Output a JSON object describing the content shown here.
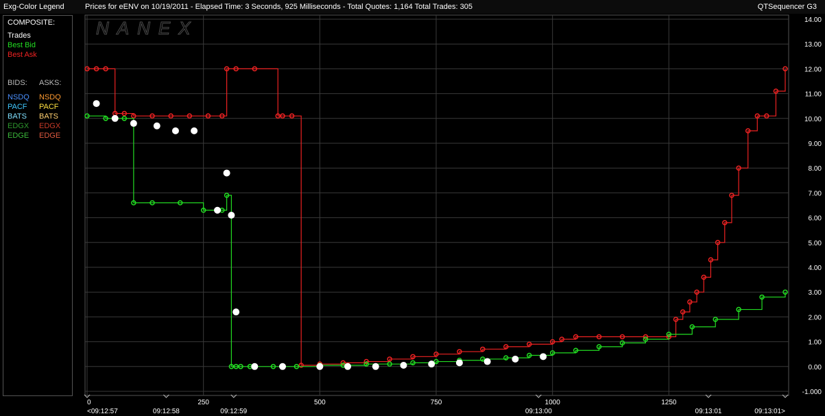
{
  "header": {
    "legend_title": "Exg-Color Legend",
    "chart_title": "Prices for  eENV  on  10/19/2011  -  Elapsed Time: 3 Seconds, 925 Milliseconds  -  Total Quotes: 1,164  Total Trades: 305",
    "app_name": "QTSequencer G3"
  },
  "watermark": "NANEX",
  "legend": {
    "composite_label": "COMPOSITE:",
    "composite": [
      {
        "label": "Trades",
        "color": "#ffffff"
      },
      {
        "label": "Best Bid",
        "color": "#22dd22"
      },
      {
        "label": "Best Ask",
        "color": "#ee2222"
      }
    ],
    "bids_label": "BIDS:",
    "asks_label": "ASKS:",
    "exchanges": [
      {
        "bid": "NSDQ",
        "bid_color": "#4a90ff",
        "ask": "NSDQ",
        "ask_color": "#ff9a30"
      },
      {
        "bid": "PACF",
        "bid_color": "#40c8ff",
        "ask": "PACF",
        "ask_color": "#ffe040"
      },
      {
        "bid": "BATS",
        "bid_color": "#80e0ff",
        "ask": "BATS",
        "ask_color": "#ffd070"
      },
      {
        "bid": "EDGX",
        "bid_color": "#2e9a2e",
        "ask": "EDGX",
        "ask_color": "#c83a28"
      },
      {
        "bid": "EDGE",
        "bid_color": "#3cbc3c",
        "ask": "EDGE",
        "ask_color": "#e05a40"
      }
    ]
  },
  "chart_data": {
    "type": "line",
    "title": "Prices for  eENV  on  10/19/2011  -  Elapsed Time: 3 Seconds, 925 Milliseconds  -  Total Quotes: 1,164  Total Trades: 305",
    "xlim": [
      0,
      1500
    ],
    "ylim": [
      -1.0,
      14.0
    ],
    "x_ticks": [
      0,
      250,
      500,
      750,
      1000,
      1250
    ],
    "x_tick_labels": [
      "0",
      "250",
      "500",
      "750",
      "1000",
      "1250"
    ],
    "y_ticks": [
      -1,
      0,
      1,
      2,
      3,
      4,
      5,
      6,
      7,
      8,
      9,
      10,
      11,
      12,
      13,
      14
    ],
    "y_tick_labels": [
      "-1.000",
      "0.00",
      "1.00",
      "2.00",
      "3.00",
      "4.00",
      "5.00",
      "6.00",
      "7.00",
      "8.00",
      "9.00",
      "10.00",
      "11.00",
      "12.00",
      "13.00",
      "14.00"
    ],
    "time_labels": [
      {
        "x": 0,
        "label": "<09:12:57"
      },
      {
        "x": 170,
        "label": "09:12:58"
      },
      {
        "x": 315,
        "label": "09:12:59"
      },
      {
        "x": 970,
        "label": "09:13:00"
      },
      {
        "x": 1335,
        "label": "09:13:01"
      },
      {
        "x": 1500,
        "label": "09:13:01>"
      }
    ],
    "grid": true,
    "series": [
      {
        "name": "Best Ask",
        "color": "#ee2222",
        "x": [
          0,
          20,
          40,
          60,
          80,
          100,
          140,
          180,
          220,
          260,
          290,
          300,
          320,
          360,
          410,
          420,
          440,
          460,
          500,
          550,
          600,
          650,
          700,
          750,
          800,
          850,
          900,
          950,
          1000,
          1020,
          1050,
          1100,
          1150,
          1200,
          1250,
          1265,
          1280,
          1295,
          1310,
          1325,
          1340,
          1355,
          1370,
          1385,
          1400,
          1420,
          1440,
          1460,
          1480,
          1500
        ],
        "y": [
          12.0,
          12.0,
          12.0,
          10.2,
          10.2,
          10.1,
          10.1,
          10.1,
          10.1,
          10.1,
          10.1,
          12.0,
          12.0,
          12.0,
          10.1,
          10.1,
          10.1,
          0.05,
          0.1,
          0.15,
          0.2,
          0.3,
          0.4,
          0.5,
          0.6,
          0.7,
          0.8,
          0.9,
          1.0,
          1.1,
          1.2,
          1.2,
          1.2,
          1.2,
          1.2,
          1.9,
          2.2,
          2.6,
          3.0,
          3.6,
          4.3,
          5.0,
          5.8,
          6.9,
          8.0,
          9.5,
          10.1,
          10.1,
          11.1,
          12.0
        ]
      },
      {
        "name": "Best Bid",
        "color": "#22dd22",
        "x": [
          0,
          40,
          80,
          100,
          140,
          200,
          250,
          290,
          300,
          310,
          320,
          330,
          350,
          400,
          450,
          500,
          550,
          600,
          650,
          700,
          750,
          800,
          850,
          900,
          950,
          1000,
          1050,
          1100,
          1150,
          1200,
          1250,
          1300,
          1350,
          1400,
          1450,
          1500
        ],
        "y": [
          10.1,
          10.0,
          10.0,
          6.6,
          6.6,
          6.6,
          6.3,
          6.3,
          6.9,
          0.0,
          0.0,
          0.0,
          0.0,
          0.0,
          0.0,
          0.05,
          0.05,
          0.1,
          0.1,
          0.15,
          0.2,
          0.25,
          0.3,
          0.35,
          0.45,
          0.55,
          0.65,
          0.8,
          0.95,
          1.1,
          1.3,
          1.6,
          1.9,
          2.3,
          2.8,
          3.0
        ]
      },
      {
        "name": "Trades",
        "color": "#ffffff",
        "x": [
          20,
          60,
          100,
          150,
          190,
          230,
          280,
          300,
          310,
          320,
          360,
          420,
          500,
          560,
          620,
          680,
          740,
          800,
          860,
          920,
          980
        ],
        "y": [
          10.6,
          10.0,
          9.8,
          9.7,
          9.5,
          9.5,
          6.3,
          7.8,
          6.1,
          2.2,
          0.0,
          0.0,
          0.0,
          0.0,
          0.0,
          0.05,
          0.1,
          0.15,
          0.2,
          0.3,
          0.4
        ]
      }
    ]
  }
}
